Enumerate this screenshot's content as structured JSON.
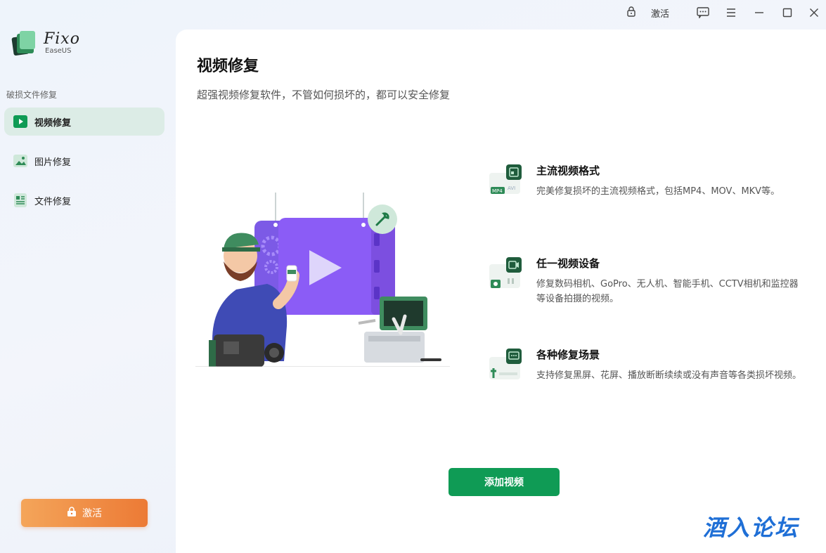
{
  "app": {
    "name": "Fixo",
    "brand": "EaseUS"
  },
  "titlebar": {
    "activate_label": "激活",
    "icons": [
      "lock-icon",
      "feedback-icon",
      "menu-icon",
      "minimize-icon",
      "maximize-icon",
      "close-icon"
    ]
  },
  "sidebar": {
    "section_label": "破损文件修复",
    "items": [
      {
        "label": "视频修复",
        "icon": "video-icon",
        "active": true
      },
      {
        "label": "图片修复",
        "icon": "image-icon",
        "active": false
      },
      {
        "label": "文件修复",
        "icon": "document-icon",
        "active": false
      }
    ],
    "activate_button": "激活"
  },
  "main": {
    "title": "视频修复",
    "subtitle": "超强视频修复软件，不管如何损坏的，都可以安全修复",
    "features": [
      {
        "title": "主流视频格式",
        "desc": "完美修复损坏的主流视频格式，包括MP4、MOV、MKV等。",
        "icon": "video-format-icon",
        "badge": "MP4",
        "badge2": "AVI"
      },
      {
        "title": "任一视频设备",
        "desc": "修复数码相机、GoPro、无人机、智能手机、CCTV相机和监控器等设备拍摄的视频。",
        "icon": "camera-device-icon"
      },
      {
        "title": "各种修复场景",
        "desc": "支持修复黑屏、花屏、播放断断续续或没有声音等各类损坏视频。",
        "icon": "repair-scene-icon"
      }
    ],
    "add_button": "添加视频"
  },
  "watermark": "酒入论坛",
  "colors": {
    "accent_green": "#0f9b55",
    "activate_orange": "#ec7a35",
    "active_nav_bg": "#dcece6",
    "illustration_purple": "#8b5cf6",
    "watermark_blue": "#1f6fd6"
  }
}
